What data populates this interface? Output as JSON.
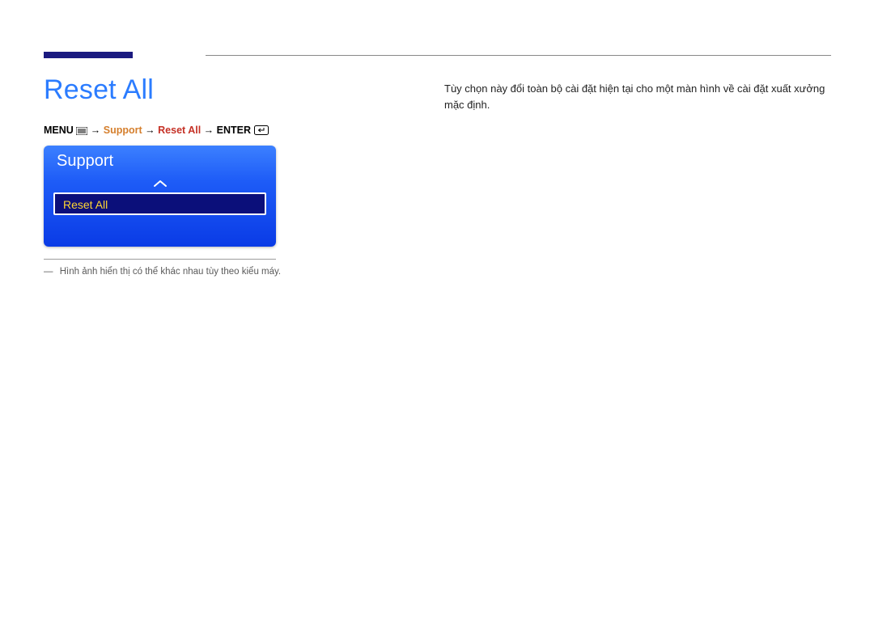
{
  "heading": "Reset All",
  "breadcrumb": {
    "menu": "MENU",
    "arrow1": " → ",
    "support": "Support",
    "arrow2": " → ",
    "reset": "Reset All",
    "arrow3": " → ",
    "enter": "ENTER"
  },
  "panel": {
    "title": "Support",
    "selected_item": "Reset All"
  },
  "footnote": {
    "dash": "―",
    "text": "Hình ảnh hiển thị có thể khác nhau tùy theo kiểu máy."
  },
  "body_text": "Tùy chọn này đổi toàn bộ cài đặt hiện tại cho một màn hình về cài đặt xuất xưởng mặc định."
}
